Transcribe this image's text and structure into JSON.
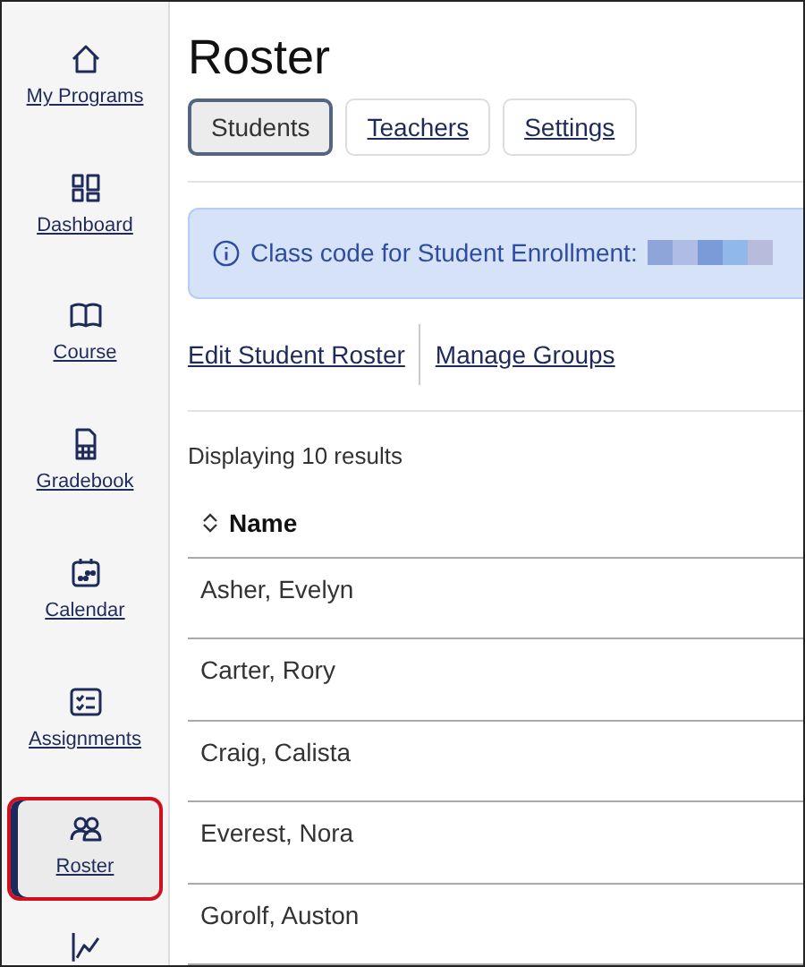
{
  "sidebar": {
    "items": [
      {
        "label": "My Programs",
        "selected": false
      },
      {
        "label": "Dashboard",
        "selected": false
      },
      {
        "label": "Course",
        "selected": false
      },
      {
        "label": "Gradebook",
        "selected": false
      },
      {
        "label": "Calendar",
        "selected": false
      },
      {
        "label": "Assignments",
        "selected": false
      },
      {
        "label": "Roster",
        "selected": true
      }
    ]
  },
  "page": {
    "title": "Roster",
    "tabs": [
      {
        "label": "Students",
        "selected": true
      },
      {
        "label": "Teachers",
        "selected": false
      },
      {
        "label": "Settings",
        "selected": false
      }
    ],
    "banner": {
      "text": "Class code for Student Enrollment:"
    },
    "actions": [
      "Edit Student Roster",
      "Manage Groups"
    ],
    "result_count": "Displaying 10 results",
    "table": {
      "columns": [
        "Name"
      ],
      "rows": [
        [
          "Asher, Evelyn"
        ],
        [
          "Carter, Rory"
        ],
        [
          "Craig, Calista"
        ],
        [
          "Everest, Nora"
        ],
        [
          "Gorolf, Auston"
        ]
      ]
    }
  }
}
